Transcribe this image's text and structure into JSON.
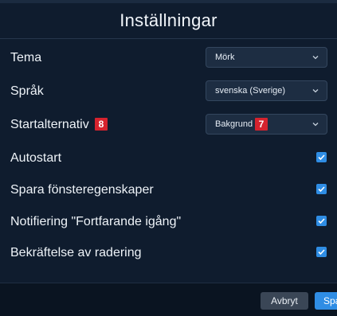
{
  "dialog": {
    "title": "Inställningar"
  },
  "settings": {
    "theme": {
      "label": "Tema",
      "value": "Mörk"
    },
    "language": {
      "label": "Språk",
      "value": "svenska (Sverige)"
    },
    "startup": {
      "label": "Startalternativ",
      "value": "Bakgrund",
      "label_badge": "8",
      "value_badge": "7"
    },
    "autostart": {
      "label": "Autostart",
      "checked": true
    },
    "save_window": {
      "label": "Spara fönsteregenskaper",
      "checked": true
    },
    "notify_ongoing": {
      "label": "Notifiering \"Fortfarande igång\"",
      "checked": true
    },
    "confirm_delete": {
      "label": "Bekräftelse av radering",
      "checked": true
    }
  },
  "footer": {
    "cancel_label": "Avbryt",
    "save_label": "Spa"
  },
  "colors": {
    "accent": "#2f8de4",
    "badge": "#d6232e",
    "background": "#0f1c2e"
  },
  "icons": {
    "dropdown": "chevron-down-icon",
    "check": "checkmark-icon"
  }
}
